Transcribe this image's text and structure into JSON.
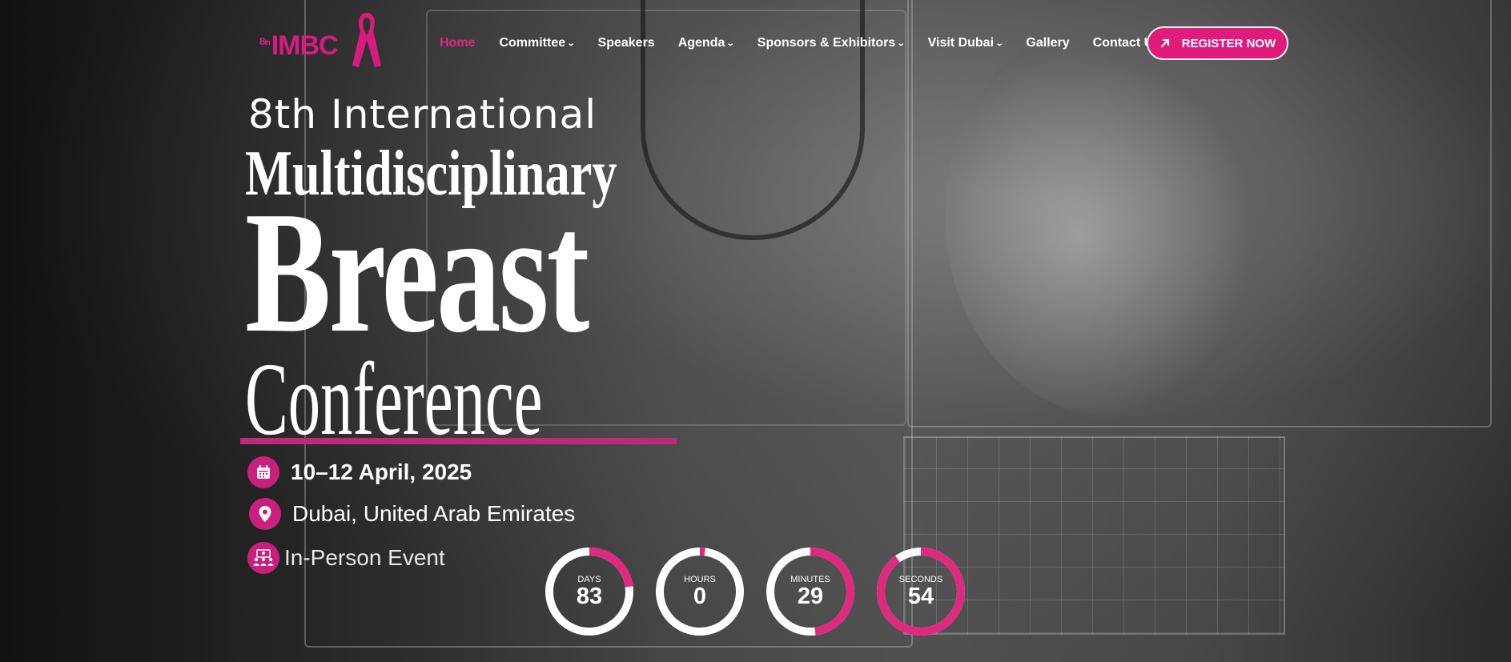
{
  "logo": {
    "superscript": "8",
    "superscript_suffix": "th",
    "name": "IMBC",
    "brand_color": "#d81b7f"
  },
  "nav": {
    "items": [
      {
        "label": "Home",
        "active": true,
        "dropdown": false
      },
      {
        "label": "Committee",
        "active": false,
        "dropdown": true
      },
      {
        "label": "Speakers",
        "active": false,
        "dropdown": false
      },
      {
        "label": "Agenda",
        "active": false,
        "dropdown": true
      },
      {
        "label": "Sponsors & Exhibitors",
        "active": false,
        "dropdown": true
      },
      {
        "label": "Visit Dubai",
        "active": false,
        "dropdown": true
      },
      {
        "label": "Gallery",
        "active": false,
        "dropdown": false
      },
      {
        "label": "Contact Us",
        "active": false,
        "dropdown": false
      }
    ],
    "register_label": "REGISTER NOW",
    "register_icon": "arrow-up-right-icon",
    "accent_color": "#e01b7c"
  },
  "hero": {
    "line1": "8th International",
    "line2": "Multidisciplinary",
    "line3": "Breast",
    "line4": "Conference",
    "date": "10–12 April, 2025",
    "date_icon": "calendar-icon",
    "location": "Dubai, United Arab Emirates",
    "location_icon": "map-pin-icon",
    "event_type": "In-Person Event",
    "event_type_icon": "people-group-icon"
  },
  "countdown": [
    {
      "label": "DAYS",
      "value": "83",
      "progress": 0.23
    },
    {
      "label": "HOURS",
      "value": "0",
      "progress": 0.02
    },
    {
      "label": "MINUTES",
      "value": "29",
      "progress": 0.48
    },
    {
      "label": "SECONDS",
      "value": "54",
      "progress": 0.9
    }
  ],
  "countdown_colors": {
    "track": "#ffffff",
    "progress": "#e0287f"
  }
}
